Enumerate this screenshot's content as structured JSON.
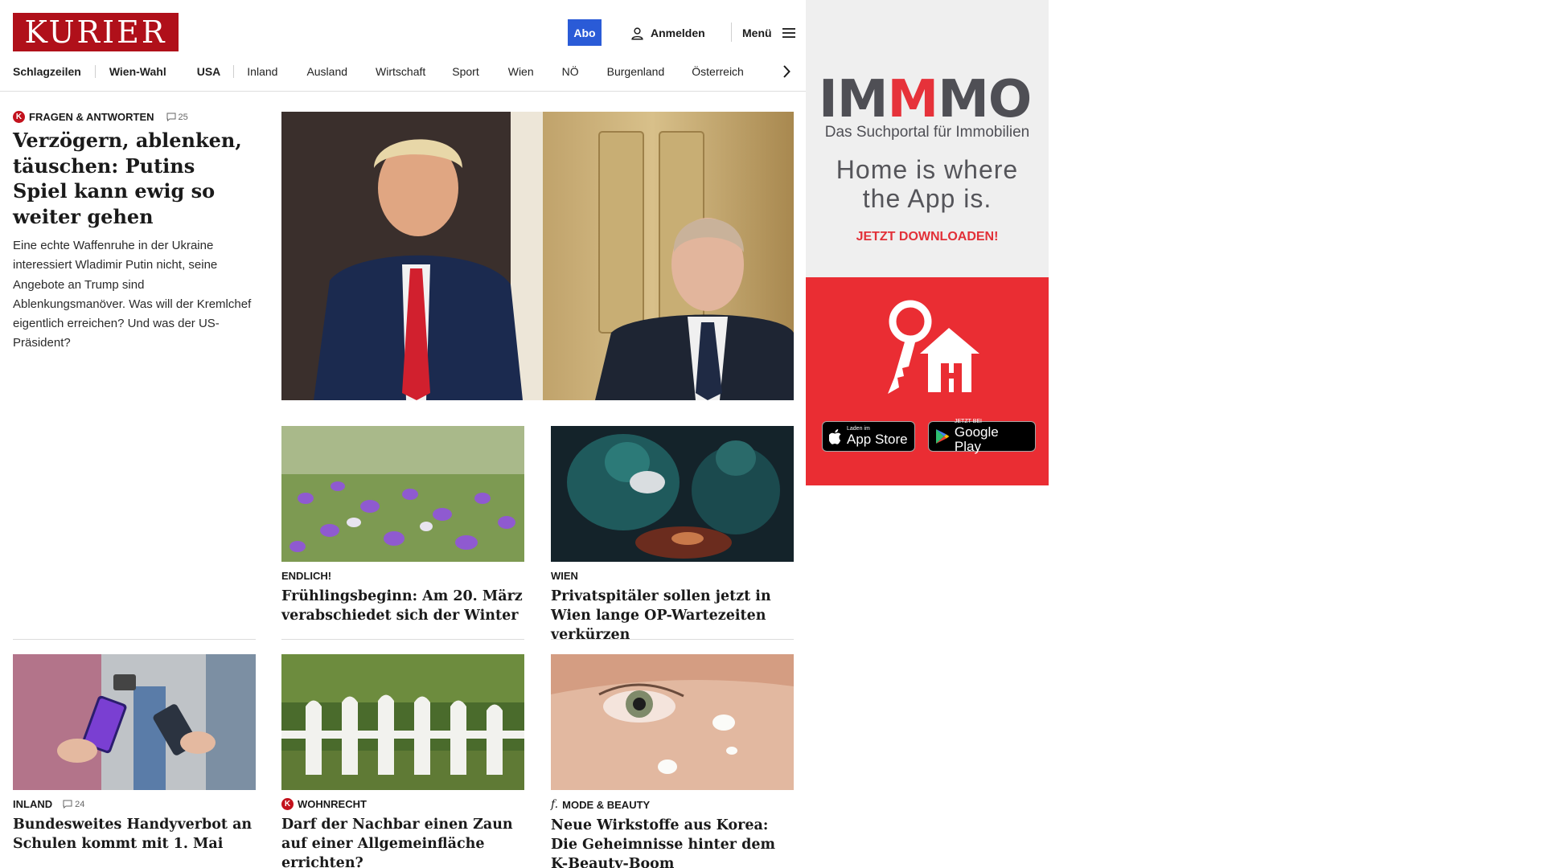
{
  "header": {
    "logo": "KURIER",
    "abo_label": "Abo",
    "login_label": "Anmelden",
    "menu_label": "Menü"
  },
  "nav": {
    "items": [
      "Schlagzeilen",
      "Wien-Wahl",
      "USA",
      "Inland",
      "Ausland",
      "Wirtschaft",
      "Sport",
      "Wien",
      "NÖ",
      "Burgenland",
      "Österreich"
    ]
  },
  "lead": {
    "kicker": "Fragen & Antworten",
    "badge": "K",
    "comments": "25",
    "title": "Verzögern, ablenken, täuschen: Putins Spiel kann ewig so weiter gehen",
    "teaser": "Eine echte Waffenruhe in der Ukraine interessiert Wladimir Putin nicht, seine Angebote an Trump sind Ablenkungsmanöver. Was will der Kremlchef eigentlich erreichen? Und was der US-Präsident?"
  },
  "cards": [
    {
      "kicker": "Endlich!",
      "title": "Frühlingsbeginn: Am 20. März verabschiedet sich der Winter"
    },
    {
      "kicker": "Wien",
      "title": "Privatspitäler sollen jetzt in Wien lange OP-Wartezeiten verkürzen"
    },
    {
      "kicker": "Inland",
      "comments": "24",
      "title": "Bundesweites Handyverbot an Schulen kommt mit 1. Mai"
    },
    {
      "kicker": "Wohnrecht",
      "badge": "K",
      "title": "Darf der Nachbar einen Zaun auf einer Allgemeinfläche errichten?"
    },
    {
      "kicker": "Mode & Beauty",
      "badge": "f.",
      "title": "Neue Wirkstoffe aus Korea: Die Geheimnisse hinter dem K-Beauty-Boom"
    }
  ],
  "ad": {
    "brand_a": "IM",
    "brand_b": "M",
    "brand_c": "MO",
    "subtitle": "Das Suchportal für Immobilien",
    "slogan_line1": "Home is where",
    "slogan_line2": "the App is.",
    "cta": "JETZT DOWNLOADEN!",
    "appstore_small": "Laden im",
    "appstore_big": "App Store",
    "googleplay_small": "JETZT BEI",
    "googleplay_big": "Google Play"
  },
  "colors": {
    "brand_red": "#b0101a",
    "abo_blue": "#2a5bd7",
    "ad_red": "#ea2d33"
  }
}
